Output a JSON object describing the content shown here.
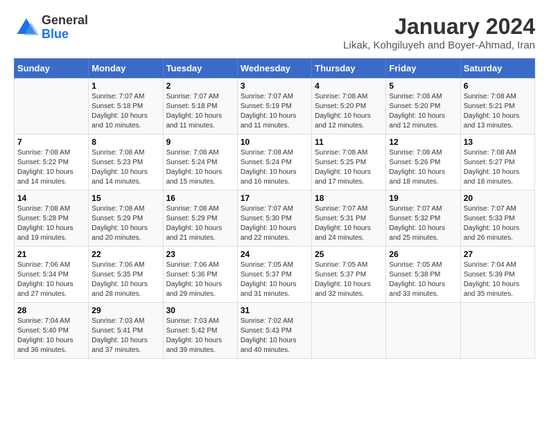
{
  "logo": {
    "line1": "General",
    "line2": "Blue"
  },
  "title": "January 2024",
  "subtitle": "Likak, Kohgiluyeh and Boyer-Ahmad, Iran",
  "days_header": [
    "Sunday",
    "Monday",
    "Tuesday",
    "Wednesday",
    "Thursday",
    "Friday",
    "Saturday"
  ],
  "weeks": [
    [
      {
        "day": "",
        "sunrise": "",
        "sunset": "",
        "daylight": ""
      },
      {
        "day": "1",
        "sunrise": "Sunrise: 7:07 AM",
        "sunset": "Sunset: 5:18 PM",
        "daylight": "Daylight: 10 hours and 10 minutes."
      },
      {
        "day": "2",
        "sunrise": "Sunrise: 7:07 AM",
        "sunset": "Sunset: 5:18 PM",
        "daylight": "Daylight: 10 hours and 11 minutes."
      },
      {
        "day": "3",
        "sunrise": "Sunrise: 7:07 AM",
        "sunset": "Sunset: 5:19 PM",
        "daylight": "Daylight: 10 hours and 11 minutes."
      },
      {
        "day": "4",
        "sunrise": "Sunrise: 7:08 AM",
        "sunset": "Sunset: 5:20 PM",
        "daylight": "Daylight: 10 hours and 12 minutes."
      },
      {
        "day": "5",
        "sunrise": "Sunrise: 7:08 AM",
        "sunset": "Sunset: 5:20 PM",
        "daylight": "Daylight: 10 hours and 12 minutes."
      },
      {
        "day": "6",
        "sunrise": "Sunrise: 7:08 AM",
        "sunset": "Sunset: 5:21 PM",
        "daylight": "Daylight: 10 hours and 13 minutes."
      }
    ],
    [
      {
        "day": "7",
        "sunrise": "Sunrise: 7:08 AM",
        "sunset": "Sunset: 5:22 PM",
        "daylight": "Daylight: 10 hours and 14 minutes."
      },
      {
        "day": "8",
        "sunrise": "Sunrise: 7:08 AM",
        "sunset": "Sunset: 5:23 PM",
        "daylight": "Daylight: 10 hours and 14 minutes."
      },
      {
        "day": "9",
        "sunrise": "Sunrise: 7:08 AM",
        "sunset": "Sunset: 5:24 PM",
        "daylight": "Daylight: 10 hours and 15 minutes."
      },
      {
        "day": "10",
        "sunrise": "Sunrise: 7:08 AM",
        "sunset": "Sunset: 5:24 PM",
        "daylight": "Daylight: 10 hours and 16 minutes."
      },
      {
        "day": "11",
        "sunrise": "Sunrise: 7:08 AM",
        "sunset": "Sunset: 5:25 PM",
        "daylight": "Daylight: 10 hours and 17 minutes."
      },
      {
        "day": "12",
        "sunrise": "Sunrise: 7:08 AM",
        "sunset": "Sunset: 5:26 PM",
        "daylight": "Daylight: 10 hours and 18 minutes."
      },
      {
        "day": "13",
        "sunrise": "Sunrise: 7:08 AM",
        "sunset": "Sunset: 5:27 PM",
        "daylight": "Daylight: 10 hours and 18 minutes."
      }
    ],
    [
      {
        "day": "14",
        "sunrise": "Sunrise: 7:08 AM",
        "sunset": "Sunset: 5:28 PM",
        "daylight": "Daylight: 10 hours and 19 minutes."
      },
      {
        "day": "15",
        "sunrise": "Sunrise: 7:08 AM",
        "sunset": "Sunset: 5:29 PM",
        "daylight": "Daylight: 10 hours and 20 minutes."
      },
      {
        "day": "16",
        "sunrise": "Sunrise: 7:08 AM",
        "sunset": "Sunset: 5:29 PM",
        "daylight": "Daylight: 10 hours and 21 minutes."
      },
      {
        "day": "17",
        "sunrise": "Sunrise: 7:07 AM",
        "sunset": "Sunset: 5:30 PM",
        "daylight": "Daylight: 10 hours and 22 minutes."
      },
      {
        "day": "18",
        "sunrise": "Sunrise: 7:07 AM",
        "sunset": "Sunset: 5:31 PM",
        "daylight": "Daylight: 10 hours and 24 minutes."
      },
      {
        "day": "19",
        "sunrise": "Sunrise: 7:07 AM",
        "sunset": "Sunset: 5:32 PM",
        "daylight": "Daylight: 10 hours and 25 minutes."
      },
      {
        "day": "20",
        "sunrise": "Sunrise: 7:07 AM",
        "sunset": "Sunset: 5:33 PM",
        "daylight": "Daylight: 10 hours and 26 minutes."
      }
    ],
    [
      {
        "day": "21",
        "sunrise": "Sunrise: 7:06 AM",
        "sunset": "Sunset: 5:34 PM",
        "daylight": "Daylight: 10 hours and 27 minutes."
      },
      {
        "day": "22",
        "sunrise": "Sunrise: 7:06 AM",
        "sunset": "Sunset: 5:35 PM",
        "daylight": "Daylight: 10 hours and 28 minutes."
      },
      {
        "day": "23",
        "sunrise": "Sunrise: 7:06 AM",
        "sunset": "Sunset: 5:36 PM",
        "daylight": "Daylight: 10 hours and 29 minutes."
      },
      {
        "day": "24",
        "sunrise": "Sunrise: 7:05 AM",
        "sunset": "Sunset: 5:37 PM",
        "daylight": "Daylight: 10 hours and 31 minutes."
      },
      {
        "day": "25",
        "sunrise": "Sunrise: 7:05 AM",
        "sunset": "Sunset: 5:37 PM",
        "daylight": "Daylight: 10 hours and 32 minutes."
      },
      {
        "day": "26",
        "sunrise": "Sunrise: 7:05 AM",
        "sunset": "Sunset: 5:38 PM",
        "daylight": "Daylight: 10 hours and 33 minutes."
      },
      {
        "day": "27",
        "sunrise": "Sunrise: 7:04 AM",
        "sunset": "Sunset: 5:39 PM",
        "daylight": "Daylight: 10 hours and 35 minutes."
      }
    ],
    [
      {
        "day": "28",
        "sunrise": "Sunrise: 7:04 AM",
        "sunset": "Sunset: 5:40 PM",
        "daylight": "Daylight: 10 hours and 36 minutes."
      },
      {
        "day": "29",
        "sunrise": "Sunrise: 7:03 AM",
        "sunset": "Sunset: 5:41 PM",
        "daylight": "Daylight: 10 hours and 37 minutes."
      },
      {
        "day": "30",
        "sunrise": "Sunrise: 7:03 AM",
        "sunset": "Sunset: 5:42 PM",
        "daylight": "Daylight: 10 hours and 39 minutes."
      },
      {
        "day": "31",
        "sunrise": "Sunrise: 7:02 AM",
        "sunset": "Sunset: 5:43 PM",
        "daylight": "Daylight: 10 hours and 40 minutes."
      },
      {
        "day": "",
        "sunrise": "",
        "sunset": "",
        "daylight": ""
      },
      {
        "day": "",
        "sunrise": "",
        "sunset": "",
        "daylight": ""
      },
      {
        "day": "",
        "sunrise": "",
        "sunset": "",
        "daylight": ""
      }
    ]
  ]
}
